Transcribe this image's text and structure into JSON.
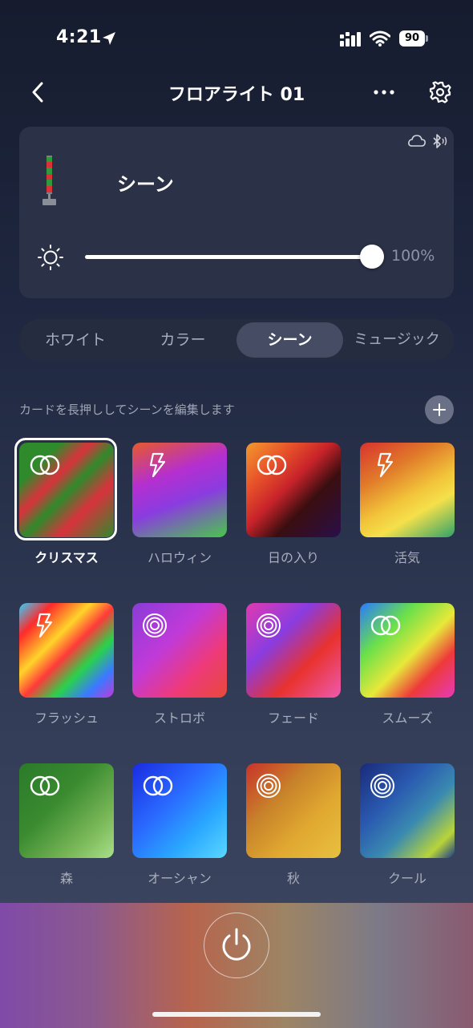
{
  "status_bar": {
    "time": "4:21",
    "battery": "90"
  },
  "header": {
    "title": "フロアライト 01"
  },
  "device": {
    "mode_label": "シーン",
    "brightness_text": "100%",
    "brightness_value": 100
  },
  "tabs": [
    {
      "label": "ホワイト",
      "active": false
    },
    {
      "label": "カラー",
      "active": false
    },
    {
      "label": "シーン",
      "active": true
    },
    {
      "label": "ミュージック",
      "active": false
    }
  ],
  "hint": "カードを長押ししてシーンを編集します",
  "scenes": [
    {
      "label": "クリスマス",
      "icon": "rings-icon",
      "selected": true
    },
    {
      "label": "ハロウィン",
      "icon": "lightning-icon",
      "selected": false
    },
    {
      "label": "日の入り",
      "icon": "rings-icon",
      "selected": false
    },
    {
      "label": "活気",
      "icon": "lightning-icon",
      "selected": false
    },
    {
      "label": "フラッシュ",
      "icon": "lightning-icon",
      "selected": false
    },
    {
      "label": "ストロボ",
      "icon": "concentric-icon",
      "selected": false
    },
    {
      "label": "フェード",
      "icon": "concentric-icon",
      "selected": false
    },
    {
      "label": "スムーズ",
      "icon": "rings-icon",
      "selected": false
    },
    {
      "label": "森",
      "icon": "rings-icon",
      "selected": false
    },
    {
      "label": "オーシャン",
      "icon": "rings-icon",
      "selected": false
    },
    {
      "label": "秋",
      "icon": "concentric-icon",
      "selected": false
    },
    {
      "label": "クール",
      "icon": "concentric-icon",
      "selected": false
    }
  ]
}
